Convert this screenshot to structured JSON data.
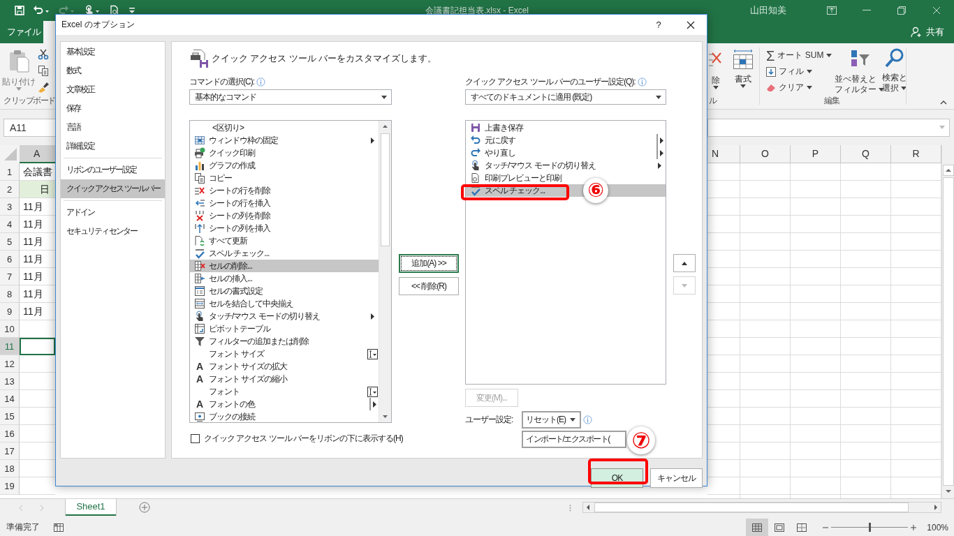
{
  "excel": {
    "quick_access": [
      {
        "disabled": false
      },
      {
        "disabled": false
      },
      {
        "disabled": true
      },
      {
        "disabled": false
      },
      {
        "disabled": false
      }
    ],
    "document_title": "会議書記担当表.xlsx - Excel",
    "user": "山田知美",
    "file_tab": "ファイル",
    "share": "共有",
    "ribbon": {
      "paste": "貼り付け",
      "clipboard_group": "クリップボード",
      "delete": "除",
      "format": "書式",
      "cells_group": "ル",
      "autosum_icon": "Σ",
      "autosum": "オート SUM",
      "fill": "フィル",
      "clear": "クリア",
      "sort_filter": [
        "並べ替えと",
        "フィルター"
      ],
      "find_select": [
        "検索と",
        "選択"
      ],
      "editing_group": "編集"
    },
    "name_box": "A11",
    "column_a": "A",
    "columns_right": [
      "N",
      "O",
      "P",
      "Q",
      "R"
    ],
    "rows": [
      {
        "number": "1",
        "cell": "会議書",
        "selected": false
      },
      {
        "number": "2",
        "cell": "日",
        "kind": "header",
        "selected": false
      },
      {
        "number": "3",
        "cell": "11月",
        "selected": false
      },
      {
        "number": "4",
        "cell": "11月",
        "selected": false
      },
      {
        "number": "5",
        "cell": "11月",
        "selected": false
      },
      {
        "number": "6",
        "cell": "11月",
        "selected": false
      },
      {
        "number": "7",
        "cell": "11月",
        "selected": false
      },
      {
        "number": "8",
        "cell": "11月",
        "selected": false
      },
      {
        "number": "9",
        "cell": "11月",
        "selected": false
      },
      {
        "number": "10",
        "selected": false
      },
      {
        "number": "11",
        "selected": true
      },
      {
        "number": "12",
        "selected": false
      },
      {
        "number": "13",
        "selected": false
      },
      {
        "number": "14",
        "selected": false
      },
      {
        "number": "15",
        "selected": false
      },
      {
        "number": "16",
        "selected": false
      },
      {
        "number": "17",
        "selected": false
      },
      {
        "number": "18",
        "selected": false
      },
      {
        "number": "19",
        "selected": false
      }
    ],
    "sheet_tabs": [
      {
        "label": "Sheet1",
        "selected": true
      }
    ],
    "status": "準備完了",
    "views": [
      {
        "selected": true
      },
      {
        "selected": false
      },
      {
        "selected": false
      }
    ],
    "zoom": {
      "level": 0.5,
      "reading": "100%"
    }
  },
  "dialog": {
    "title": "Excel のオプション",
    "help": "?",
    "nav": [
      {
        "items": [
          {
            "label": "基本設定",
            "selected": false
          },
          {
            "label": "数式",
            "selected": false
          },
          {
            "label": "文章校正",
            "selected": false
          },
          {
            "label": "保存",
            "selected": false
          },
          {
            "label": "言語",
            "selected": false
          },
          {
            "label": "詳細設定",
            "selected": false
          }
        ]
      },
      {
        "items": [
          {
            "label": "リボンのユーザー設定",
            "selected": false
          },
          {
            "label": "クイック アクセス ツール バー",
            "selected": true
          }
        ]
      },
      {
        "items": [
          {
            "label": "アドイン",
            "selected": false
          },
          {
            "label": "セキュリティ センター",
            "selected": false
          }
        ]
      }
    ],
    "heading": "クイック アクセス ツール バーをカスタマイズします。",
    "commands": {
      "label": "コマンドの選択(C):",
      "dropdown": "基本的なコマンド",
      "items": [
        {
          "label": "<区切り>",
          "selected": false,
          "kind": "plain"
        },
        {
          "label": "ウィンドウ枠の固定",
          "selected": false,
          "kind": "submenu"
        },
        {
          "label": "クイック印刷",
          "selected": false,
          "kind": "plain"
        },
        {
          "label": "グラフの作成",
          "selected": false,
          "kind": "plain"
        },
        {
          "label": "コピー",
          "selected": false,
          "kind": "plain"
        },
        {
          "label": "シートの行を削除",
          "selected": false,
          "kind": "plain"
        },
        {
          "label": "シートの行を挿入",
          "selected": false,
          "kind": "plain"
        },
        {
          "label": "シートの列を削除",
          "selected": false,
          "kind": "plain"
        },
        {
          "label": "シートの列を挿入",
          "selected": false,
          "kind": "plain"
        },
        {
          "label": "すべて更新",
          "selected": false,
          "kind": "plain"
        },
        {
          "label": "スペル チェック...",
          "selected": false,
          "kind": "plain"
        },
        {
          "label": "セルの削除...",
          "selected": true,
          "kind": "plain"
        },
        {
          "label": "セルの挿入...",
          "selected": false,
          "kind": "plain"
        },
        {
          "label": "セルの書式設定",
          "selected": false,
          "kind": "plain"
        },
        {
          "label": "セルを結合して中央揃え",
          "selected": false,
          "kind": "plain"
        },
        {
          "label": "タッチ/マウス モードの切り替え",
          "selected": false,
          "kind": "submenu"
        },
        {
          "label": "ピボットテーブル",
          "selected": false,
          "kind": "plain"
        },
        {
          "label": "フィルターの追加または削除",
          "selected": false,
          "kind": "plain"
        },
        {
          "label": "フォント サイズ",
          "selected": false,
          "kind": "textbox"
        },
        {
          "label": "フォント サイズの拡大",
          "selected": false,
          "glyph": "A",
          "kind": "plain"
        },
        {
          "label": "フォント サイズの縮小",
          "selected": false,
          "glyph": "A",
          "kind": "plain"
        },
        {
          "label": "フォント",
          "selected": false,
          "kind": "textbox"
        },
        {
          "label": "フォントの色",
          "selected": false,
          "glyph": "A",
          "kind": "split"
        },
        {
          "label": "ブックの接続",
          "selected": false,
          "kind": "plain"
        }
      ],
      "show_below_ribbon": {
        "label": "クイック アクセス ツール バーをリボンの下に表示する(H)",
        "checked": false
      }
    },
    "add_button": "追加(A) >>",
    "remove_button": "<< 削除(R)",
    "toolbar": {
      "label": "クイック アクセス ツール バーのユーザー設定(Q):",
      "dropdown": "すべてのドキュメントに適用 (既定)",
      "items": [
        {
          "label": "上書き保存",
          "selected": false,
          "kind": "plain"
        },
        {
          "label": "元に戻す",
          "selected": false,
          "kind": "split"
        },
        {
          "label": "やり直し",
          "selected": false,
          "kind": "split"
        },
        {
          "label": "タッチ/マウス モードの切り替え",
          "selected": false,
          "kind": "submenu"
        },
        {
          "label": "印刷プレビューと印刷",
          "selected": false,
          "kind": "plain"
        },
        {
          "label": "スペル チェック...",
          "selected": true,
          "kind": "plain"
        }
      ],
      "move_up": {
        "disabled": false
      },
      "move_down": {
        "disabled": true
      },
      "modify_button": {
        "label": "変更(M)...",
        "disabled": true
      },
      "customizations_label": "ユーザー設定:",
      "reset_button": "リセット(E)",
      "import_export_button": "インポート/エクスポート("
    },
    "ok": "OK",
    "cancel": "キャンセル",
    "annotations": [
      {
        "label": "⑥"
      },
      {
        "label": "⑦"
      }
    ]
  }
}
